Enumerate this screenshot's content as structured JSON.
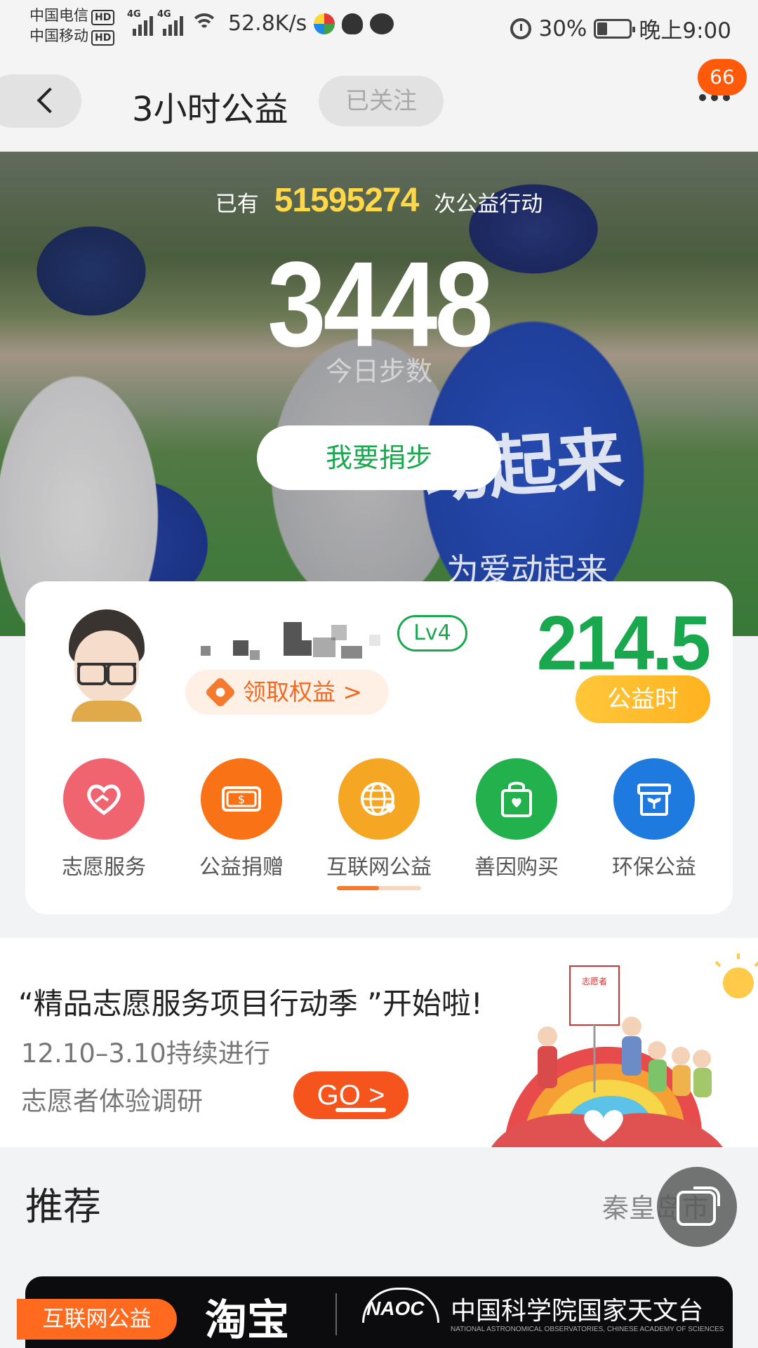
{
  "status_bar": {
    "carrier_1": "中国电信",
    "carrier_2": "中国移动",
    "hd": "HD",
    "network": "4G",
    "speed": "52.8K/s",
    "battery": "30%",
    "time": "晚上9:00"
  },
  "header": {
    "title": "3小时公益",
    "follow_label": "已关注",
    "badge_count": "66"
  },
  "hero": {
    "prefix": "已有",
    "action_count": "51595274",
    "suffix": "次公益行动",
    "steps": "3448",
    "steps_label": "今日步数",
    "donate_label": "我要捐步",
    "vest_text": "动起来",
    "vest_sub": "为爱动起来"
  },
  "profile": {
    "level": "Lv4",
    "rights_label": "领取权益 >",
    "hours_value": "214.5",
    "hours_label": "公益时"
  },
  "categories": [
    {
      "label": "志愿服务",
      "color": "#f06470",
      "icon": "heart-hand-icon"
    },
    {
      "label": "公益捐赠",
      "color": "#f97316",
      "icon": "money-icon"
    },
    {
      "label": "互联网公益",
      "color": "#f5a623",
      "icon": "globe-heart-icon"
    },
    {
      "label": "善因购买",
      "color": "#22b14c",
      "icon": "shopping-bag-icon"
    },
    {
      "label": "环保公益",
      "color": "#1f7ae0",
      "icon": "eco-box-icon"
    }
  ],
  "banner": {
    "title": "“精品志愿服务项目行动季 ”开始啦!",
    "subtitle_1": "12.10–3.10持续进行",
    "subtitle_2": "志愿者体验调研",
    "go_label": "GO >"
  },
  "recommend": {
    "title": "推荐",
    "city": "秦皇岛市"
  },
  "bottom_card": {
    "tag": "互联网公益",
    "brand": "淘宝",
    "partner_abbr": "NAOC",
    "partner_name": "中国科学院国家天文台",
    "partner_en": "NATIONAL ASTRONOMICAL OBSERVATORIES, CHINESE ACADEMY OF SCIENCES"
  }
}
